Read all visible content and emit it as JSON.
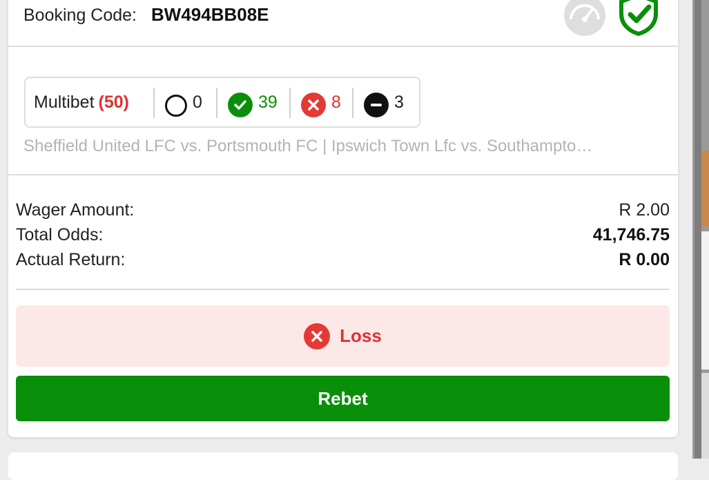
{
  "header": {
    "booking_label": "Booking Code:",
    "booking_code": "BW494BB08E",
    "icons": [
      "gauge-icon",
      "shield-check-icon"
    ]
  },
  "multibet": {
    "label": "Multibet",
    "count": "(50)",
    "stats": {
      "open": "0",
      "won": "39",
      "lost": "8",
      "void": "3"
    }
  },
  "matches_text": "Sheffield United LFC vs. Portsmouth FC | Ipswich Town Lfc vs. Southampto…",
  "summary": {
    "wager_label": "Wager Amount:",
    "wager_value": "R 2.00",
    "odds_label": "Total Odds:",
    "odds_value": "41,746.75",
    "return_label": "Actual Return:",
    "return_value": "R 0.00"
  },
  "result": {
    "label": "Loss",
    "icon": "x-circle-icon"
  },
  "rebet_label": "Rebet",
  "colors": {
    "green": "#0a8f0a",
    "red": "#e03131",
    "loss_bg": "#fde8e8",
    "muted": "#b3b3b3"
  }
}
